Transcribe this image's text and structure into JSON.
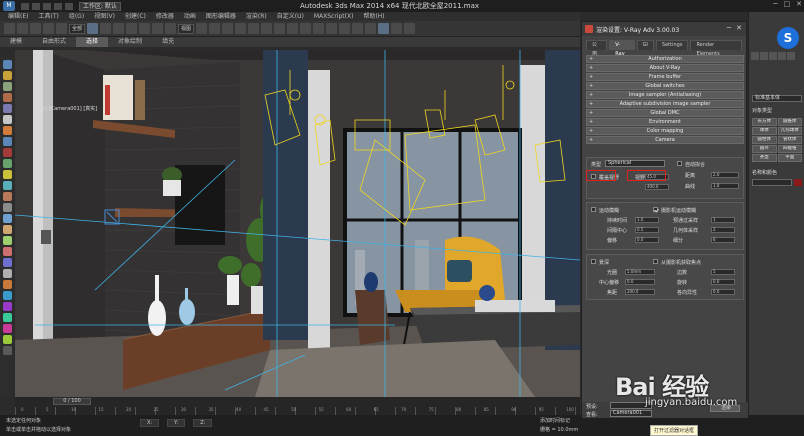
{
  "titlebar": {
    "app_icon": "3ds-max-icon",
    "workspace": "工作区: 默认",
    "title": "Autodesk 3ds Max  2014 x64      现代北欧全屋2011.max",
    "window_buttons": [
      "─",
      "□",
      "✕"
    ]
  },
  "menubar": {
    "items": [
      "编辑(E)",
      "工具(T)",
      "组(G)",
      "视图(V)",
      "创建(C)",
      "修改器",
      "动画",
      "图形编辑器",
      "渲染(R)",
      "自定义(U)",
      "MAXScript(X)",
      "帮助(H)"
    ]
  },
  "toolbar": {
    "selection_filter": "全部",
    "view_dropdown": "视图"
  },
  "ribbon": {
    "tabs": [
      "建模",
      "自由形式",
      "选择",
      "对象绘制",
      "填充"
    ],
    "active_index": 2
  },
  "viewport": {
    "label": "[+] [Camera001] [真实]"
  },
  "timeline": {
    "frame": "0 / 100",
    "ticks": [
      "0",
      "5",
      "10",
      "15",
      "20",
      "25",
      "30",
      "35",
      "40",
      "45",
      "50",
      "55",
      "60",
      "65",
      "70",
      "75",
      "80",
      "85",
      "90",
      "95",
      "100"
    ]
  },
  "statusbar": {
    "line1": "未选定任何对象",
    "line2": "单击或单击并拖动以选择对象",
    "x": "X:",
    "y": "Y:",
    "z": "Z:",
    "grid": "栅格 = 10.0mm",
    "add_time_tag": "添加时间标记",
    "tooltip": "打开过滤器对话框"
  },
  "dialog": {
    "title": "渲染设置: V-Ray Adv 3.00.03",
    "tabs": [
      "公用",
      "V-Ray",
      "GI",
      "Settings",
      "Render Elements"
    ],
    "active_tab": 1,
    "rollouts": [
      "Authorization",
      "About V-Ray",
      "Frame buffer",
      "Global switches",
      "Image sampler (Antialiasing)",
      "Adaptive subdivision image sampler",
      "Global DMC",
      "Environment",
      "Color mapping",
      "Camera"
    ],
    "camera": {
      "type_label": "类型",
      "type_value": "Spherical",
      "override_fov_label": "覆盖视野",
      "fov_label": "视野",
      "fov_value": "45.0",
      "height_label": "高度",
      "height_value": "400.0",
      "cylinder_label": "圆柱高度",
      "auto_fit_label": "自动拟合",
      "dist_label": "距离",
      "dist_value": "2.0",
      "curve_label": "曲线",
      "curve_value": "1.0"
    },
    "motion_blur": {
      "enable_label": "运动模糊",
      "camera_mb_label": "摄影机运动模糊",
      "duration_label": "持续时间",
      "duration_value": "1.0",
      "interval_label": "间隔中心",
      "interval_value": "0.5",
      "bias_label": "偏移",
      "bias_value": "0.0",
      "prepass_label": "预通过采样",
      "prepass_value": "1",
      "geom_label": "几何体采样",
      "geom_value": "2",
      "subdivs_label": "细分",
      "subdivs_value": "6"
    },
    "dof": {
      "enable_label": "景深",
      "from_camera_label": "从摄影机获取焦点",
      "aperture_label": "光圈",
      "aperture_value": "5.0mm",
      "center_bias_label": "中心偏移",
      "center_bias_value": "0.0",
      "focal_label": "焦距",
      "focal_value": "200.0",
      "sides_label": "边数",
      "sides_value": "5",
      "rotation_label": "旋转",
      "rotation_value": "0.0",
      "anisotropy_label": "各向异性",
      "anisotropy_value": "0.0"
    },
    "footer": {
      "preset_label": "预设:",
      "view_label": "查看:",
      "view_value": "Camera001",
      "render_button": "渲染"
    }
  },
  "cmdpanel": {
    "logo": "S",
    "standard": "标准基本体",
    "object_type": "对象类型",
    "buttons": [
      "长方体",
      "圆锥体",
      "球体",
      "几何球体",
      "圆柱体",
      "管状体",
      "圆环",
      "四棱锥",
      "茶壶",
      "平面"
    ],
    "name_color": "名称和颜色",
    "swatch_color": "#8b1a1a"
  },
  "watermark": {
    "brand": "Bai 经验",
    "url": "jingyan.baidu.com"
  }
}
